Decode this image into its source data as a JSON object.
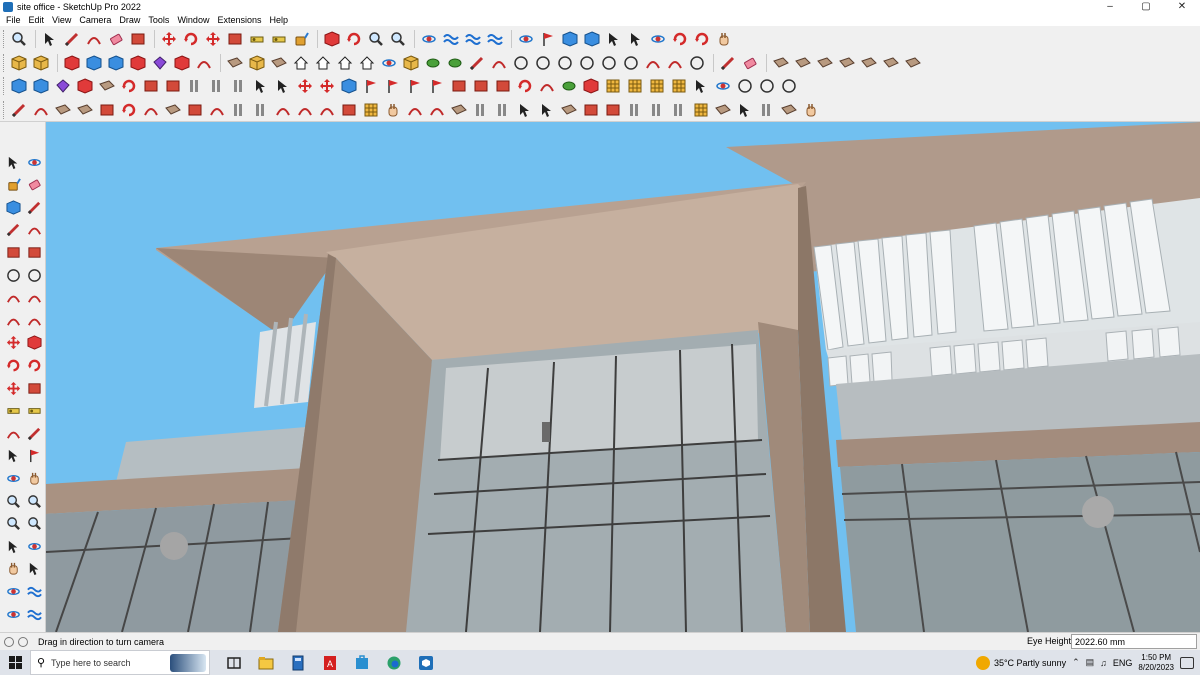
{
  "window": {
    "title": "site office - SketchUp Pro 2022",
    "controls": [
      "–",
      "▢",
      "✕"
    ]
  },
  "menu": [
    "File",
    "Edit",
    "View",
    "Camera",
    "Draw",
    "Tools",
    "Window",
    "Extensions",
    "Help"
  ],
  "status": {
    "message": "Drag in direction to turn camera",
    "measure_label": "Eye Height",
    "measure_value": "2022.60 mm"
  },
  "taskbar": {
    "search_placeholder": "Type here to search",
    "apps": [
      "task-view",
      "file-explorer",
      "calculator",
      "acrobat",
      "store",
      "edge",
      "sketchup"
    ],
    "weather": "35°C  Partly sunny",
    "language": "ENG",
    "time": "1:50 PM",
    "date": "8/20/2023"
  },
  "colors": {
    "sky": "#6fbfef",
    "facade": "#a8907f",
    "facade_light": "#c9b3a4",
    "glass": "#9aa5aa",
    "accent_red": "#d22020",
    "accent_blue": "#1e6fd0"
  }
}
